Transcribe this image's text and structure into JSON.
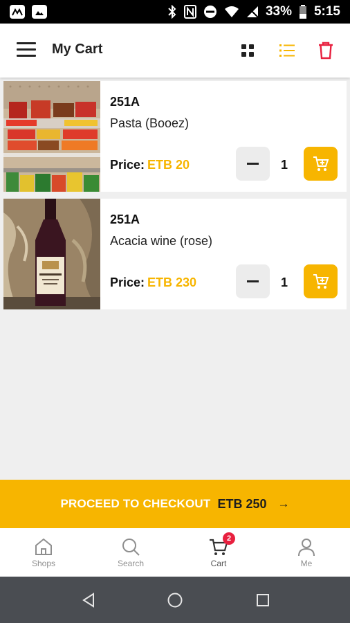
{
  "status_bar": {
    "battery": "33%",
    "time": "5:15"
  },
  "appbar": {
    "title": "My Cart",
    "icons": [
      "menu-icon",
      "grid-view-icon",
      "list-view-icon",
      "trash-icon"
    ],
    "active_color": "#f7b500",
    "delete_color": "#e8203f"
  },
  "cart": {
    "price_label": "Price:",
    "items": [
      {
        "code": "251A",
        "name": "Pasta (Booez)",
        "price": "ETB 20",
        "quantity": "1"
      },
      {
        "code": "251A",
        "name": "Acacia wine (rose)",
        "price": "ETB 230",
        "quantity": "1"
      }
    ]
  },
  "checkout": {
    "label": "PROCEED TO CHECKOUT",
    "total": "ETB 250",
    "arrow": "→"
  },
  "bottom_nav": {
    "items": [
      {
        "label": "Shops",
        "icon": "shop-icon"
      },
      {
        "label": "Search",
        "icon": "search-icon"
      },
      {
        "label": "Cart",
        "icon": "cart-icon",
        "badge": "2"
      },
      {
        "label": "Me",
        "icon": "user-icon"
      }
    ]
  },
  "colors": {
    "accent": "#f7b500",
    "badge": "#e8203f",
    "background": "#efefef"
  }
}
